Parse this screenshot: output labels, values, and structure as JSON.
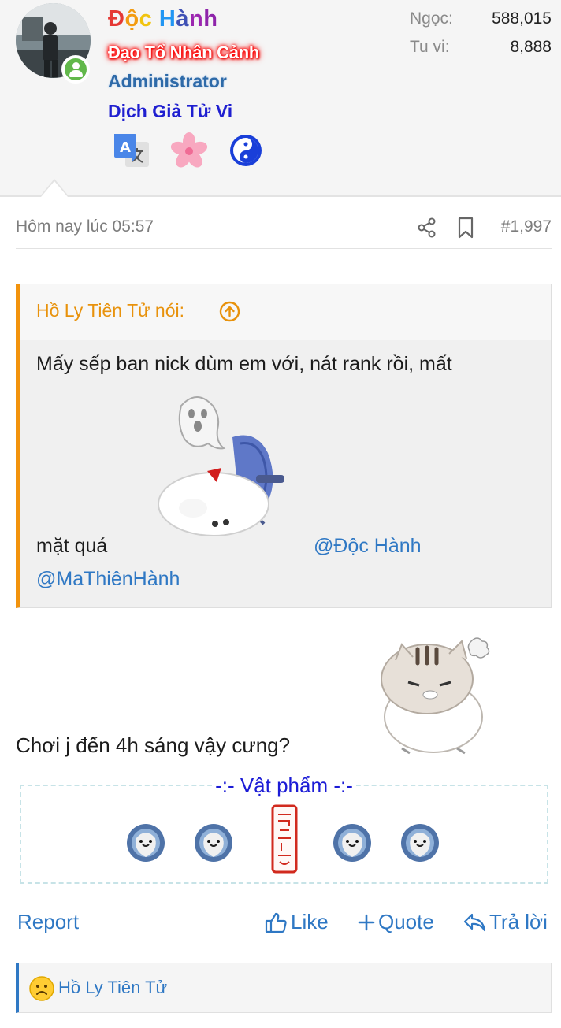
{
  "user": {
    "name_letters": [
      "Đ",
      "ộ",
      "c",
      " ",
      "H",
      "à",
      "n",
      "h"
    ],
    "title_glow": "Đạo Tổ Nhân Cảnh",
    "title_role": "Administrator",
    "title_extra": "Dịch Giả Tử Vi",
    "online": true,
    "badges": [
      "translate-icon",
      "cherry-blossom-icon",
      "yin-yang-icon"
    ],
    "stats": [
      {
        "label": "Ngọc:",
        "value": "588,015"
      },
      {
        "label": "Tu vi:",
        "value": "8,888"
      }
    ]
  },
  "meta": {
    "date": "Hôm nay lúc 05:57",
    "post_number": "#1,997"
  },
  "quote": {
    "author": "Hồ Ly Tiên Tử nói:",
    "line1": "Mấy sếp ban nick dùm em với, nát rank rồi, mất",
    "line2": "mặt quá",
    "mention1": "@Độc Hành",
    "mention2": "@MaThiênHành"
  },
  "post": {
    "text": "Chơi j đến 4h sáng vậy cưng?"
  },
  "items": {
    "title": "-:- Vật phẩm -:-"
  },
  "actions": {
    "report": "Report",
    "like": "Like",
    "quote": "Quote",
    "reply": "Trả lời"
  },
  "reactions": {
    "user": "Hồ Ly Tiên Tử"
  },
  "colors": {
    "accent": "#2f78c4",
    "quote_border": "#f2930d",
    "online": "#62b84b"
  }
}
